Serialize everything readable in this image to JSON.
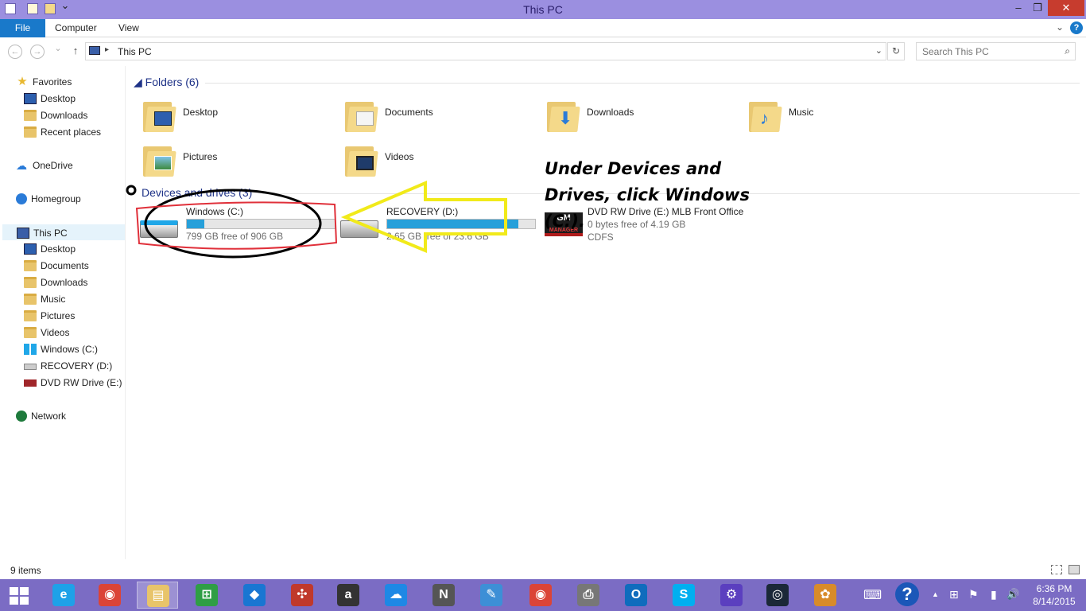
{
  "window": {
    "title": "This PC",
    "minimize_glyph": "–",
    "restore_glyph": "❐",
    "close_glyph": "✕"
  },
  "ribbon": {
    "tabs": [
      {
        "label": "File"
      },
      {
        "label": "Computer"
      },
      {
        "label": "View"
      }
    ],
    "expand_glyph": "⌄",
    "help_glyph": "?"
  },
  "address": {
    "back_glyph": "←",
    "forward_glyph": "→",
    "recent_glyph": "⌄",
    "up_glyph": "↑",
    "separator": "▸",
    "path": "This PC",
    "dropdown_glyph": "⌄",
    "refresh_glyph": "↻",
    "search_placeholder": "Search This PC",
    "search_icon": "⌕"
  },
  "sidebar": {
    "favorites": "Favorites",
    "favorites_items": [
      "Desktop",
      "Downloads",
      "Recent places"
    ],
    "onedrive": "OneDrive",
    "homegroup": "Homegroup",
    "this_pc": "This PC",
    "this_pc_items": [
      "Desktop",
      "Documents",
      "Downloads",
      "Music",
      "Pictures",
      "Videos",
      "Windows (C:)",
      "RECOVERY (D:)",
      "DVD RW Drive (E:) MLB Front Office"
    ],
    "network": "Network"
  },
  "folders": {
    "title": "Folders (6)",
    "items": [
      "Desktop",
      "Documents",
      "Downloads",
      "Music",
      "Pictures",
      "Videos"
    ]
  },
  "devices": {
    "title": "Devices and drives (3)",
    "drives": [
      {
        "name": "Windows (C:)",
        "free_text": "799 GB free of 906 GB",
        "used_fraction": 0.118
      },
      {
        "name": "RECOVERY (D:)",
        "free_text": "2.65 GB free of 23.6 GB",
        "used_fraction": 0.888
      },
      {
        "name": "DVD RW Drive (E:) MLB Front Office",
        "free_text": "0 bytes free of 4.19 GB",
        "fs": "CDFS",
        "disc_label": "GM",
        "disc_sub": "MANAGER"
      }
    ]
  },
  "annotation": "Under Devices and Drives, click Windows (C:).",
  "status": {
    "item_count": "9 items"
  },
  "taskbar": {
    "apps": [
      {
        "name": "internet-explorer",
        "glyph": "e",
        "color": "#1ea1e8"
      },
      {
        "name": "chrome",
        "glyph": "◉",
        "color": "#db4437"
      },
      {
        "name": "file-explorer",
        "glyph": "▤",
        "color": "#e8c46a"
      },
      {
        "name": "store",
        "glyph": "⊞",
        "color": "#2f9e45"
      },
      {
        "name": "dropbox",
        "glyph": "◆",
        "color": "#1976d2"
      },
      {
        "name": "puzzle",
        "glyph": "✣",
        "color": "#c0392b"
      },
      {
        "name": "amazon",
        "glyph": "a",
        "color": "#333333"
      },
      {
        "name": "onedrive",
        "glyph": "☁",
        "color": "#1e88e5"
      },
      {
        "name": "notepad",
        "glyph": "N",
        "color": "#555555"
      },
      {
        "name": "notes",
        "glyph": "✎",
        "color": "#3d8fd6"
      },
      {
        "name": "chrome-2",
        "glyph": "◉",
        "color": "#db4437"
      },
      {
        "name": "fax",
        "glyph": "⎙",
        "color": "#777777"
      },
      {
        "name": "outlook",
        "glyph": "O",
        "color": "#0f6cbd"
      },
      {
        "name": "skype",
        "glyph": "S",
        "color": "#00aff0"
      },
      {
        "name": "settings",
        "glyph": "⚙",
        "color": "#5b3fbf"
      },
      {
        "name": "steam",
        "glyph": "◎",
        "color": "#1b2838"
      },
      {
        "name": "paint",
        "glyph": "✿",
        "color": "#d88b2a"
      }
    ],
    "tray_glyphs": [
      "⌨",
      "?",
      "▲",
      "⊞",
      "⚑",
      "▮",
      "🔊"
    ],
    "time": "6:36 PM",
    "date": "8/14/2015"
  }
}
